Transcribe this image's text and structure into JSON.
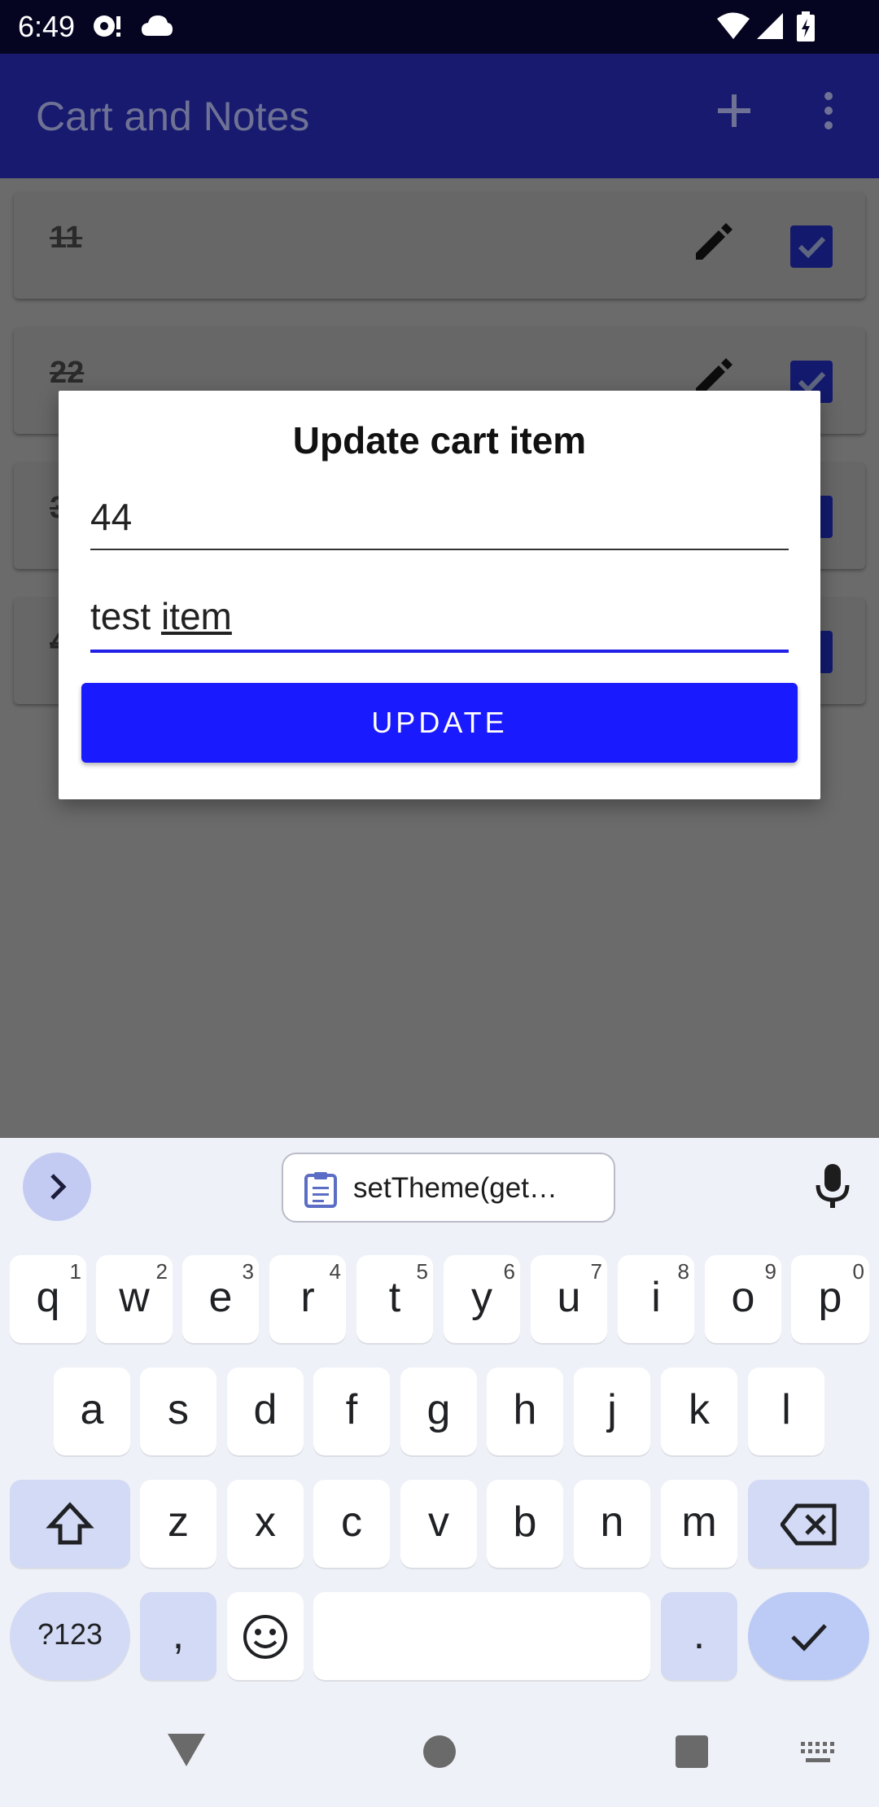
{
  "status_bar": {
    "time": "6:49"
  },
  "app_bar": {
    "title": "Cart and Notes"
  },
  "list": {
    "items": [
      {
        "text": "11"
      },
      {
        "text": "22"
      },
      {
        "text": "3"
      },
      {
        "text": "4"
      }
    ]
  },
  "dialog": {
    "title": "Update cart item",
    "quantity_value": "44",
    "name_value_plain": "test ",
    "name_value_composing": "item",
    "update_label": "UPDATE"
  },
  "keyboard": {
    "clipboard_suggestion": "setTheme(get…",
    "row1": [
      {
        "k": "q",
        "s": "1"
      },
      {
        "k": "w",
        "s": "2"
      },
      {
        "k": "e",
        "s": "3"
      },
      {
        "k": "r",
        "s": "4"
      },
      {
        "k": "t",
        "s": "5"
      },
      {
        "k": "y",
        "s": "6"
      },
      {
        "k": "u",
        "s": "7"
      },
      {
        "k": "i",
        "s": "8"
      },
      {
        "k": "o",
        "s": "9"
      },
      {
        "k": "p",
        "s": "0"
      }
    ],
    "row2": [
      "a",
      "s",
      "d",
      "f",
      "g",
      "h",
      "j",
      "k",
      "l"
    ],
    "row3": [
      "z",
      "x",
      "c",
      "v",
      "b",
      "n",
      "m"
    ],
    "symbols_label": "?123",
    "comma": ",",
    "period": "."
  },
  "colors": {
    "accent": "#1a1aff",
    "app_bar": "#171a6e",
    "status_bar": "#050521"
  }
}
